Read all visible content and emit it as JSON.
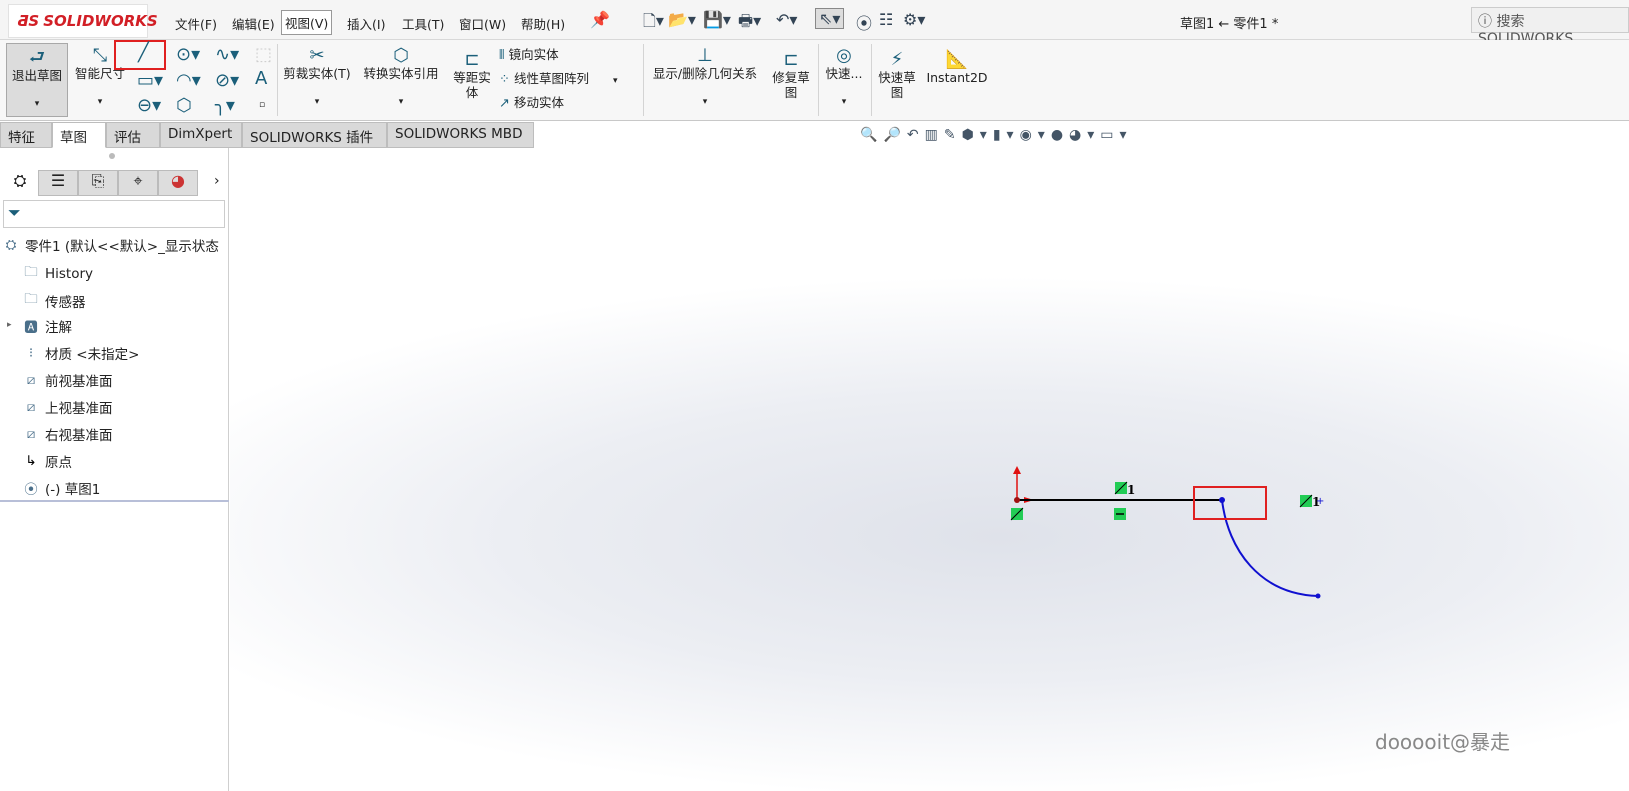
{
  "app": {
    "logo": "SOLIDWORKS",
    "title": "草图1 ← 零件1 *",
    "search_placeholder": "搜索 SOLIDWORKS"
  },
  "menu": [
    "文件(F)",
    "编辑(E)",
    "视图(V)",
    "插入(I)",
    "工具(T)",
    "窗口(W)",
    "帮助(H)"
  ],
  "ribbon": {
    "exit_sketch": "退出草图",
    "smart_dim": "智能尺寸",
    "trim": "剪裁实体(T)",
    "convert": "转换实体引用",
    "offset": "等距实\n体",
    "mirror": "镜向实体",
    "linear_pattern": "线性草图阵列",
    "move": "移动实体",
    "relations": "显示/删除几何关系",
    "repair": "修复草\n图",
    "quick_snap": "快速...",
    "rapid_sketch": "快速草\n图",
    "instant2d": "Instant2D"
  },
  "tabs": [
    "特征",
    "草图",
    "评估",
    "DimXpert",
    "SOLIDWORKS 插件",
    "SOLIDWORKS MBD"
  ],
  "active_tab": "草图",
  "tree": {
    "root": "零件1 (默认<<默认>_显示状态",
    "items": [
      "History",
      "传感器",
      "注解",
      "材质 <未指定>",
      "前视基准面",
      "上视基准面",
      "右视基准面",
      "原点",
      "(-) 草图1"
    ]
  },
  "sketch": {
    "relation_label": "1",
    "highlight_color": "#e02020",
    "line_color": "#000000",
    "arc_color": "#1010d0",
    "relation_color": "#22cc55"
  },
  "watermark": "dooooit@暴走"
}
